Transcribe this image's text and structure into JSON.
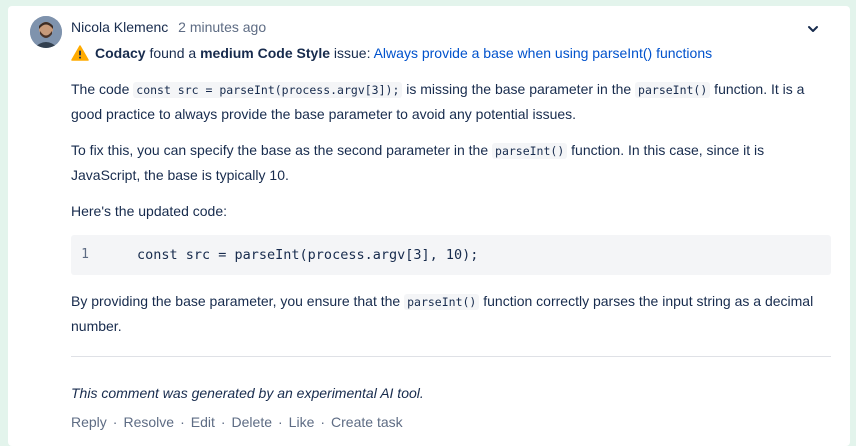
{
  "comment": {
    "author": "Nicola Klemenc",
    "time": "2 minutes ago",
    "headline": {
      "tool": "Codacy",
      "found_a": " found a ",
      "severity": "medium Code Style",
      "issue_word": " issue: ",
      "link": "Always provide a base when using parseInt() functions"
    },
    "p1": {
      "t1": "The code ",
      "c1": "const src = parseInt(process.argv[3]);",
      "t2": " is missing the base parameter in the ",
      "c2": "parseInt()",
      "t3": " function. It is a good practice to always provide the base parameter to avoid any potential issues."
    },
    "p2": {
      "t1": "To fix this, you can specify the base as the second parameter in the ",
      "c1": "parseInt()",
      "t2": " function. In this case, since it is JavaScript, the base is typically 10."
    },
    "p3": "Here's the updated code:",
    "code_block": {
      "line_number": "1",
      "code": "const src = parseInt(process.argv[3], 10);"
    },
    "p4": {
      "t1": "By providing the base parameter, you ensure that the ",
      "c1": "parseInt()",
      "t2": " function correctly parses the input string as a decimal number."
    },
    "ai_note": "This comment was generated by an experimental AI tool.",
    "actions": [
      "Reply",
      "Resolve",
      "Edit",
      "Delete",
      "Like",
      "Create task"
    ],
    "separator": "·"
  },
  "colors": {
    "link": "#0052cc",
    "warning": "#ffab00",
    "page_bg": "#e3f4ec"
  },
  "icons": {
    "warning": "warning-icon",
    "chevron": "chevron-down-icon"
  }
}
